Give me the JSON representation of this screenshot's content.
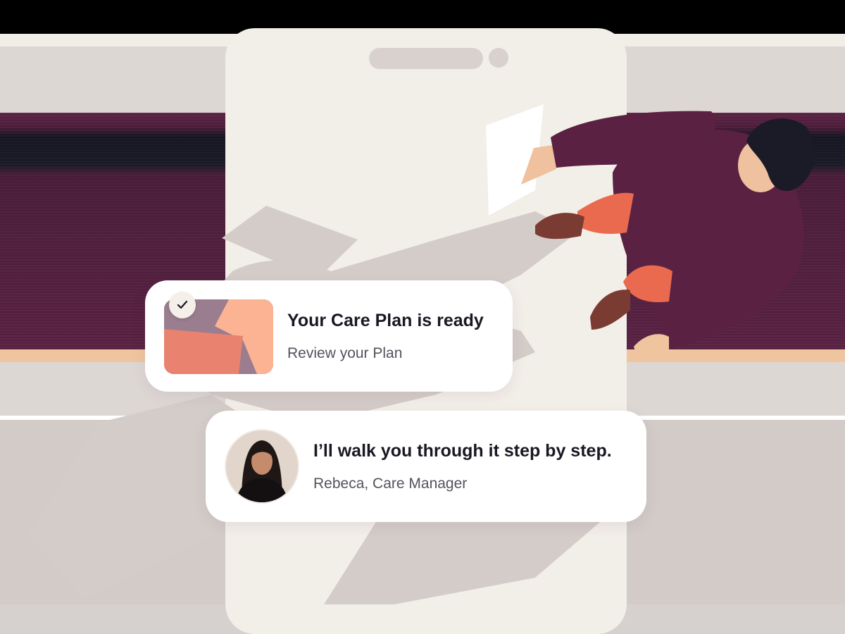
{
  "plan_card": {
    "title": "Your Care Plan is ready",
    "subtitle": "Review your Plan",
    "thumbnail_icon": "care-plan-thumbnail",
    "badge_icon": "check-icon"
  },
  "manager_card": {
    "message": "I’ll walk you through it step by step.",
    "signature": "Rebeca, Care Manager",
    "avatar_icon": "care-manager-avatar"
  },
  "colors": {
    "plum": "#5b2143",
    "coral": "#e96a4e",
    "peach": "#fbb394",
    "phone": "#f2eee8",
    "background": "#d6d0ce",
    "ink": "#1a1822"
  }
}
